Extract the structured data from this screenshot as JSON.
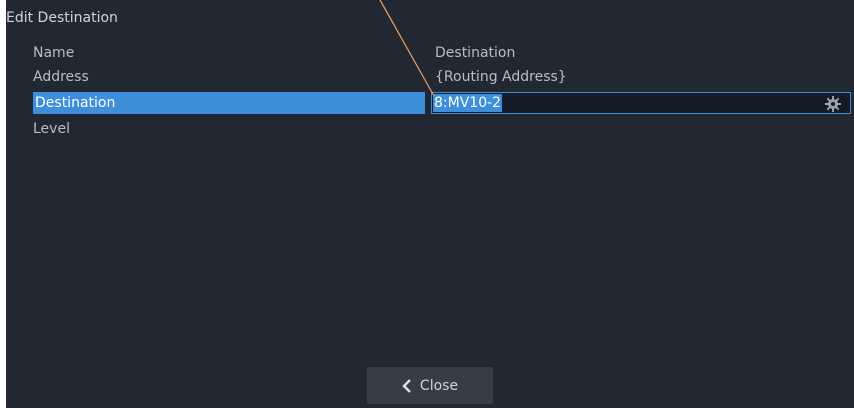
{
  "dialog": {
    "title": "Edit Destination",
    "rows": [
      {
        "label": "Name",
        "value": "Destination"
      },
      {
        "label": "Address",
        "value": "{Routing Address}"
      },
      {
        "label": "Destination",
        "value": "8:MV10-2"
      },
      {
        "label": "Level",
        "value": ""
      }
    ],
    "close_label": "Close"
  },
  "icons": {
    "edit_field": "gear-icon",
    "close": "chevron-left-icon"
  },
  "colors": {
    "background": "#222832",
    "selection": "#3d8fdc",
    "callout_line": "#f0a060"
  }
}
